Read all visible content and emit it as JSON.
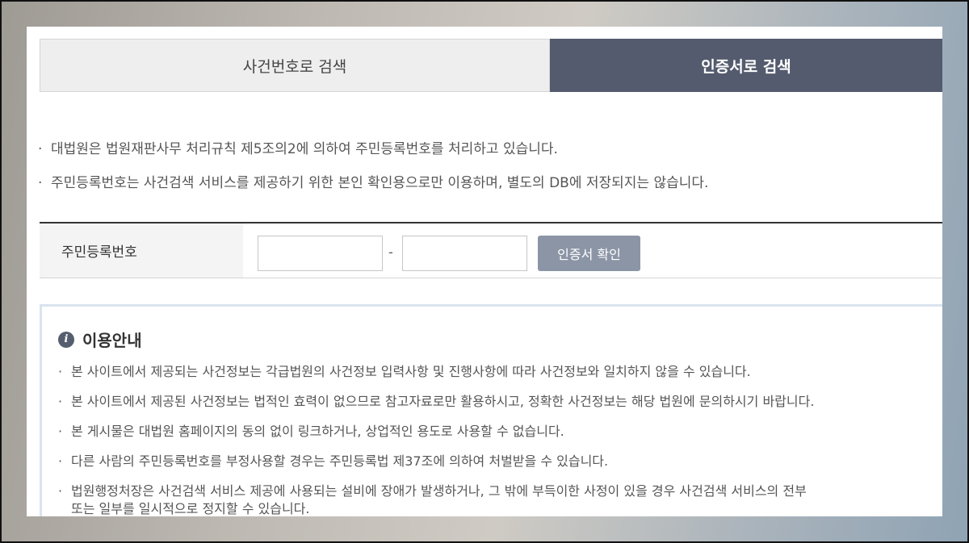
{
  "tabs": {
    "case_number": "사건번호로 검색",
    "certificate": "인증서로 검색"
  },
  "notes": [
    "대법원은 법원재판사무 처리규칙 제5조의2에 의하여 주민등록번호를 처리하고 있습니다.",
    "주민등록번호는 사건검색 서비스를 제공하기 위한 본인 확인용으로만 이용하며, 별도의 DB에 저장되지는 않습니다."
  ],
  "bullet": "·",
  "form": {
    "label": "주민등록번호",
    "first_value": "",
    "second_value": "",
    "separator": "-",
    "button": "인증서 확인"
  },
  "guide": {
    "icon": "info-icon",
    "icon_glyph": "i",
    "title": "이용안내",
    "items": [
      "본 사이트에서 제공되는 사건정보는 각급법원의 사건정보 입력사항 및 진행사항에 따라 사건정보와 일치하지 않을 수 있습니다.",
      "본 사이트에서 제공된 사건정보는 법적인 효력이 없으므로 참고자료로만 활용하시고, 정확한 사건정보는 해당 법원에 문의하시기 바랍니다.",
      "본 게시물은 대법원 홈페이지의 동의 없이 링크하거나, 상업적인 용도로 사용할 수 없습니다.",
      "다른 사람의 주민등록번호를 부정사용할 경우는 주민등록법 제37조에 의하여 처벌받을 수 있습니다.",
      "법원행정처장은 사건검색 서비스 제공에 사용되는 설비에 장애가 발생하거나, 그 밖에 부득이한 사정이 있을 경우 사건검색 서비스의 전부",
      "또는 일부를 일시적으로 정지할 수 있습니다."
    ]
  },
  "colors": {
    "active_tab": "#545b6e",
    "button": "#8b95a6",
    "guide_border": "#d9e4ee"
  }
}
